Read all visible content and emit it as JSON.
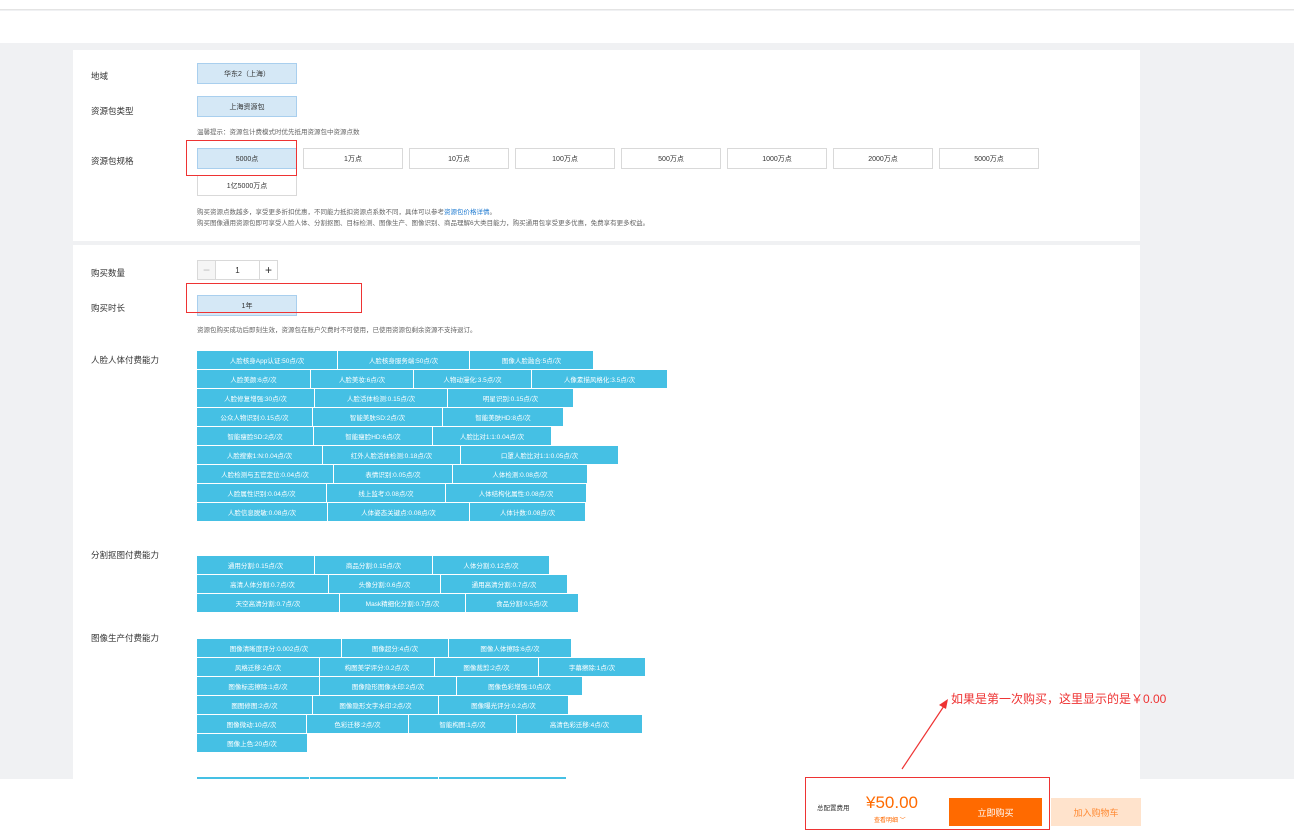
{
  "region": {
    "label": "地域",
    "selected": "华东2（上海）"
  },
  "pkg_type": {
    "label": "资源包类型",
    "selected": "上海资源包",
    "hint": "温馨提示：资源包计费模式时优先抵用资源包中资源点数"
  },
  "pkg_spec": {
    "label": "资源包规格",
    "options": [
      "5000点",
      "1万点",
      "10万点",
      "100万点",
      "500万点",
      "1000万点",
      "2000万点",
      "5000万点",
      "1亿5000万点"
    ],
    "selected": "5000点",
    "note1_prefix": "购买资源点数越多，享受更多折扣优惠，不同能力抵扣资源点系数不同，具体可以参考",
    "note1_link": "资源包价格详情",
    "note1_suffix": "。",
    "note2": "购买图像通用资源包即可享受人脸人体、分割抠图、目标检测、图像生产、图像识别、商品理解6大类目能力，购买通用包享受更多优惠，免费享有更多权益。"
  },
  "quantity": {
    "label": "购买数量",
    "minus": "−",
    "value": "1",
    "plus": "+"
  },
  "duration": {
    "label": "购买时长",
    "selected": "1年",
    "hint": "资源包购买成功后即刻生效，资源包在账户欠费时不可使用，已使用资源包剩余资源不支持退订。"
  },
  "face_group": {
    "label": "人脸人体付费能力",
    "rows": [
      [
        "人脸核身App认证:50点/次",
        "人脸核身服务端:50点/次",
        "图像人脸融合:5点/次"
      ],
      [
        "人脸美颜:6点/次",
        "人脸美妆:6点/次",
        "人物动漫化:3.5点/次",
        "人像素描风格化:3.5点/次"
      ],
      [
        "人脸修复增强:30点/次",
        "人脸活体检测:0.15点/次",
        "明星识别:0.15点/次"
      ],
      [
        "公众人物识别:0.15点/次",
        "智能美肤SD:2点/次",
        "智能美肤HD:8点/次"
      ],
      [
        "智能瘦脸SD:2点/次",
        "智能瘦脸HD:6点/次",
        "人脸比对1:1:0.04点/次"
      ],
      [
        "人脸搜索1:N:0.04点/次",
        "红外人脸活体检测:0.18点/次",
        "口罩人脸比对1:1:0.05点/次"
      ],
      [
        "人脸检测与五官定位:0.04点/次",
        "表情识别:0.05点/次",
        "人体检测:0.08点/次"
      ],
      [
        "人脸属性识别:0.04点/次",
        "线上监考:0.08点/次",
        "人体结构化属性:0.08点/次"
      ],
      [
        "人脸信息脱敏:0.08点/次",
        "人体姿态关键点:0.08点/次",
        "人体计数:0.08点/次"
      ]
    ]
  },
  "seg_group": {
    "label": "分割抠图付费能力",
    "rows": [
      [
        "通用分割:0.15点/次",
        "商品分割:0.15点/次",
        "人体分割:0.12点/次"
      ],
      [
        "高清人体分割:0.7点/次",
        "头像分割:0.6点/次",
        "通用高清分割:0.7点/次"
      ],
      [
        "天空高清分割:0.7点/次",
        "Mask精细化分割:0.7点/次",
        "食品分割:0.5点/次"
      ]
    ]
  },
  "gen_group": {
    "label": "图像生产付费能力",
    "rows": [
      [
        "图像清晰度评分:0.002点/次",
        "图像超分:4点/次",
        "图像人体擦除:6点/次"
      ],
      [
        "风格迁移:2点/次",
        "构图美学评分:0.2点/次",
        "图像裁剪:2点/次",
        "字幕擦除:1点/次"
      ],
      [
        "图像标志擦除:1点/次",
        "图像隐形图像水印:2点/次",
        "图像色彩增强:10点/次"
      ],
      [
        "图图修图:2点/次",
        "图像隐形文字水印:2点/次",
        "图像曝光评分:0.2点/次"
      ],
      [
        "图像微动:10点/次",
        "色彩迁移:2点/次",
        "智能构图:1点/次",
        "高清色彩迁移:4点/次"
      ],
      [
        "图像上色:20点/次"
      ]
    ]
  },
  "footer": {
    "total_label": "总配置费用",
    "price": "¥50.00",
    "detail": "查看明细 ﹀",
    "buy": "立即购买",
    "cart": "加入购物车"
  },
  "annotation": "如果是第一次购买，这里显示的是￥0.00"
}
